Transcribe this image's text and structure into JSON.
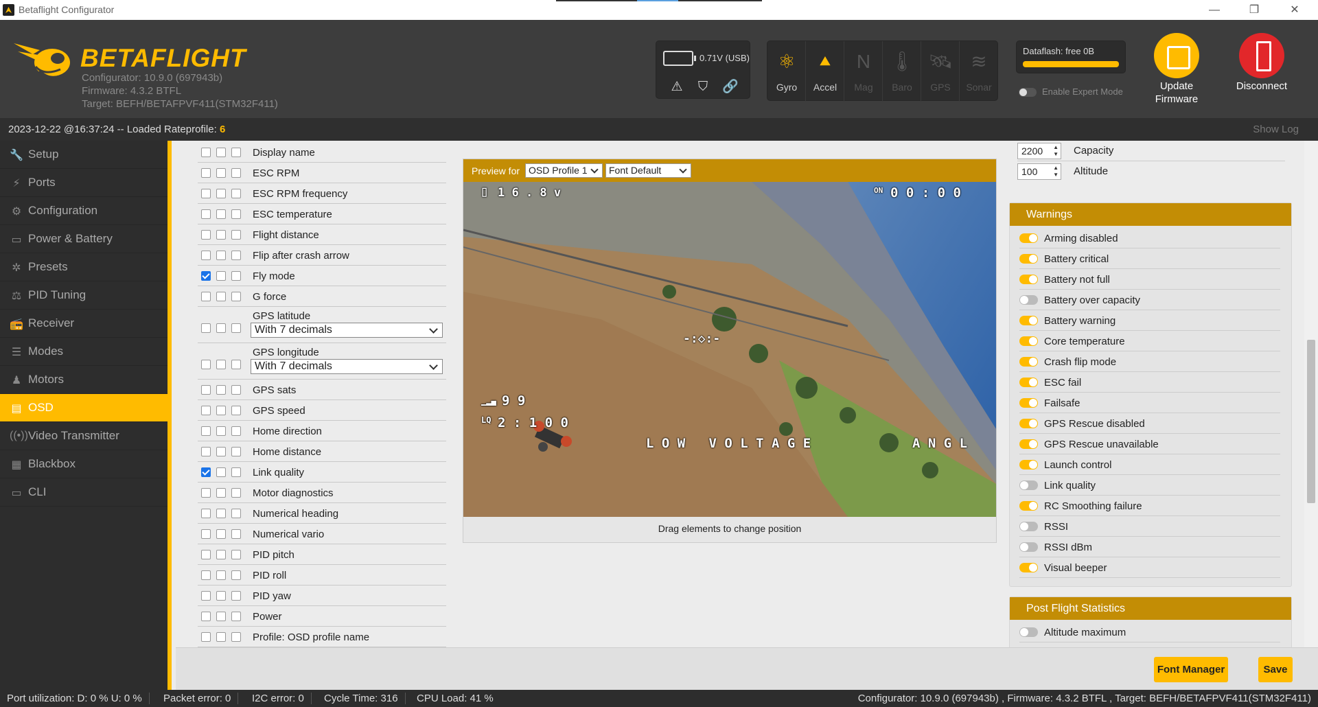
{
  "window": {
    "title": "Betaflight Configurator"
  },
  "header": {
    "logo_text": "BETAFLIGHT",
    "configurator": "Configurator: 10.9.0 (697943b)",
    "firmware": "Firmware: 4.3.2 BTFL",
    "target": "Target: BEFH/BETAFPVF411(STM32F411)",
    "battery_voltage": "0.71V (USB)",
    "sensors": [
      {
        "label": "Gyro",
        "icon": "gyro-icon",
        "active": true
      },
      {
        "label": "Accel",
        "icon": "accel-icon",
        "active": true
      },
      {
        "label": "Mag",
        "icon": "mag-icon",
        "active": false
      },
      {
        "label": "Baro",
        "icon": "baro-icon",
        "active": false
      },
      {
        "label": "GPS",
        "icon": "gps-icon",
        "active": false
      },
      {
        "label": "Sonar",
        "icon": "sonar-icon",
        "active": false
      }
    ],
    "dataflash": "Dataflash: free 0B",
    "expert_mode": "Enable Expert Mode",
    "update_firmware_1": "Update",
    "update_firmware_2": "Firmware",
    "disconnect": "Disconnect"
  },
  "status": {
    "log_prefix": "2023-12-22 @16:37:24 -- Loaded Rateprofile: ",
    "log_value": "6",
    "show_log": "Show Log"
  },
  "sidebar": [
    {
      "label": "Setup",
      "icon": "wrench-icon"
    },
    {
      "label": "Ports",
      "icon": "plug-icon"
    },
    {
      "label": "Configuration",
      "icon": "gear-icon"
    },
    {
      "label": "Power & Battery",
      "icon": "battery-icon"
    },
    {
      "label": "Presets",
      "icon": "wand-icon"
    },
    {
      "label": "PID Tuning",
      "icon": "pid-icon"
    },
    {
      "label": "Receiver",
      "icon": "receiver-icon"
    },
    {
      "label": "Modes",
      "icon": "modes-icon"
    },
    {
      "label": "Motors",
      "icon": "motor-icon"
    },
    {
      "label": "OSD",
      "icon": "osd-icon",
      "active": true
    },
    {
      "label": "Video Transmitter",
      "icon": "vtx-icon"
    },
    {
      "label": "Blackbox",
      "icon": "blackbox-icon"
    },
    {
      "label": "CLI",
      "icon": "cli-icon"
    }
  ],
  "osd_elements": [
    {
      "label": "Display name",
      "checked": false
    },
    {
      "label": "ESC RPM",
      "checked": false
    },
    {
      "label": "ESC RPM frequency",
      "checked": false
    },
    {
      "label": "ESC temperature",
      "checked": false
    },
    {
      "label": "Flight distance",
      "checked": false
    },
    {
      "label": "Flip after crash arrow",
      "checked": false
    },
    {
      "label": "Fly mode",
      "checked": true
    },
    {
      "label": "G force",
      "checked": false
    },
    {
      "label": "GPS latitude",
      "checked": false,
      "select": "With 7 decimals"
    },
    {
      "label": "GPS longitude",
      "checked": false,
      "select": "With 7 decimals"
    },
    {
      "label": "GPS sats",
      "checked": false
    },
    {
      "label": "GPS speed",
      "checked": false
    },
    {
      "label": "Home direction",
      "checked": false
    },
    {
      "label": "Home distance",
      "checked": false
    },
    {
      "label": "Link quality",
      "checked": true
    },
    {
      "label": "Motor diagnostics",
      "checked": false
    },
    {
      "label": "Numerical heading",
      "checked": false
    },
    {
      "label": "Numerical vario",
      "checked": false
    },
    {
      "label": "PID pitch",
      "checked": false
    },
    {
      "label": "PID roll",
      "checked": false
    },
    {
      "label": "PID yaw",
      "checked": false
    },
    {
      "label": "Power",
      "checked": false
    },
    {
      "label": "Profile: OSD profile name",
      "checked": false
    }
  ],
  "preview": {
    "label": "Preview for",
    "profile": "OSD Profile 1",
    "font": "Font Default",
    "drag_note": "Drag elements to change position",
    "osd": {
      "voltage": "1 6 . 8 v",
      "timer": "0 0 : 0 0",
      "rssi": "9 9",
      "lq": "2 : 1 0 0",
      "warning": "L O W   V O L T A G E",
      "mode": "A N G L"
    }
  },
  "right": {
    "inputs": [
      {
        "value": "2200",
        "label": "Capacity"
      },
      {
        "value": "100",
        "label": "Altitude"
      }
    ],
    "warnings_title": "Warnings",
    "warnings": [
      {
        "label": "Arming disabled",
        "on": true
      },
      {
        "label": "Battery critical",
        "on": true
      },
      {
        "label": "Battery not full",
        "on": true
      },
      {
        "label": "Battery over capacity",
        "on": false
      },
      {
        "label": "Battery warning",
        "on": true
      },
      {
        "label": "Core temperature",
        "on": true
      },
      {
        "label": "Crash flip mode",
        "on": true
      },
      {
        "label": "ESC fail",
        "on": true
      },
      {
        "label": "Failsafe",
        "on": true
      },
      {
        "label": "GPS Rescue disabled",
        "on": true
      },
      {
        "label": "GPS Rescue unavailable",
        "on": true
      },
      {
        "label": "Launch control",
        "on": true
      },
      {
        "label": "Link quality",
        "on": false
      },
      {
        "label": "RC Smoothing failure",
        "on": true
      },
      {
        "label": "RSSI",
        "on": false
      },
      {
        "label": "RSSI dBm",
        "on": false
      },
      {
        "label": "Visual beeper",
        "on": true
      }
    ],
    "stats_title": "Post Flight Statistics",
    "stats": [
      {
        "label": "Altitude maximum",
        "on": false
      }
    ]
  },
  "toolbar": {
    "font_manager": "Font Manager",
    "save": "Save"
  },
  "footer": {
    "port": "Port utilization: D: 0 % U: 0 %",
    "packet": "Packet error: 0",
    "i2c": "I2C error: 0",
    "cycle": "Cycle Time: 316",
    "cpu": "CPU Load: 41 %",
    "info": "Configurator: 10.9.0 (697943b) , Firmware: 4.3.2 BTFL , Target: BEFH/BETAFPVF411(STM32F411)"
  },
  "colors": {
    "accent": "#ffbb00",
    "section_header": "#c38d05",
    "disconnect": "#e2272a"
  }
}
